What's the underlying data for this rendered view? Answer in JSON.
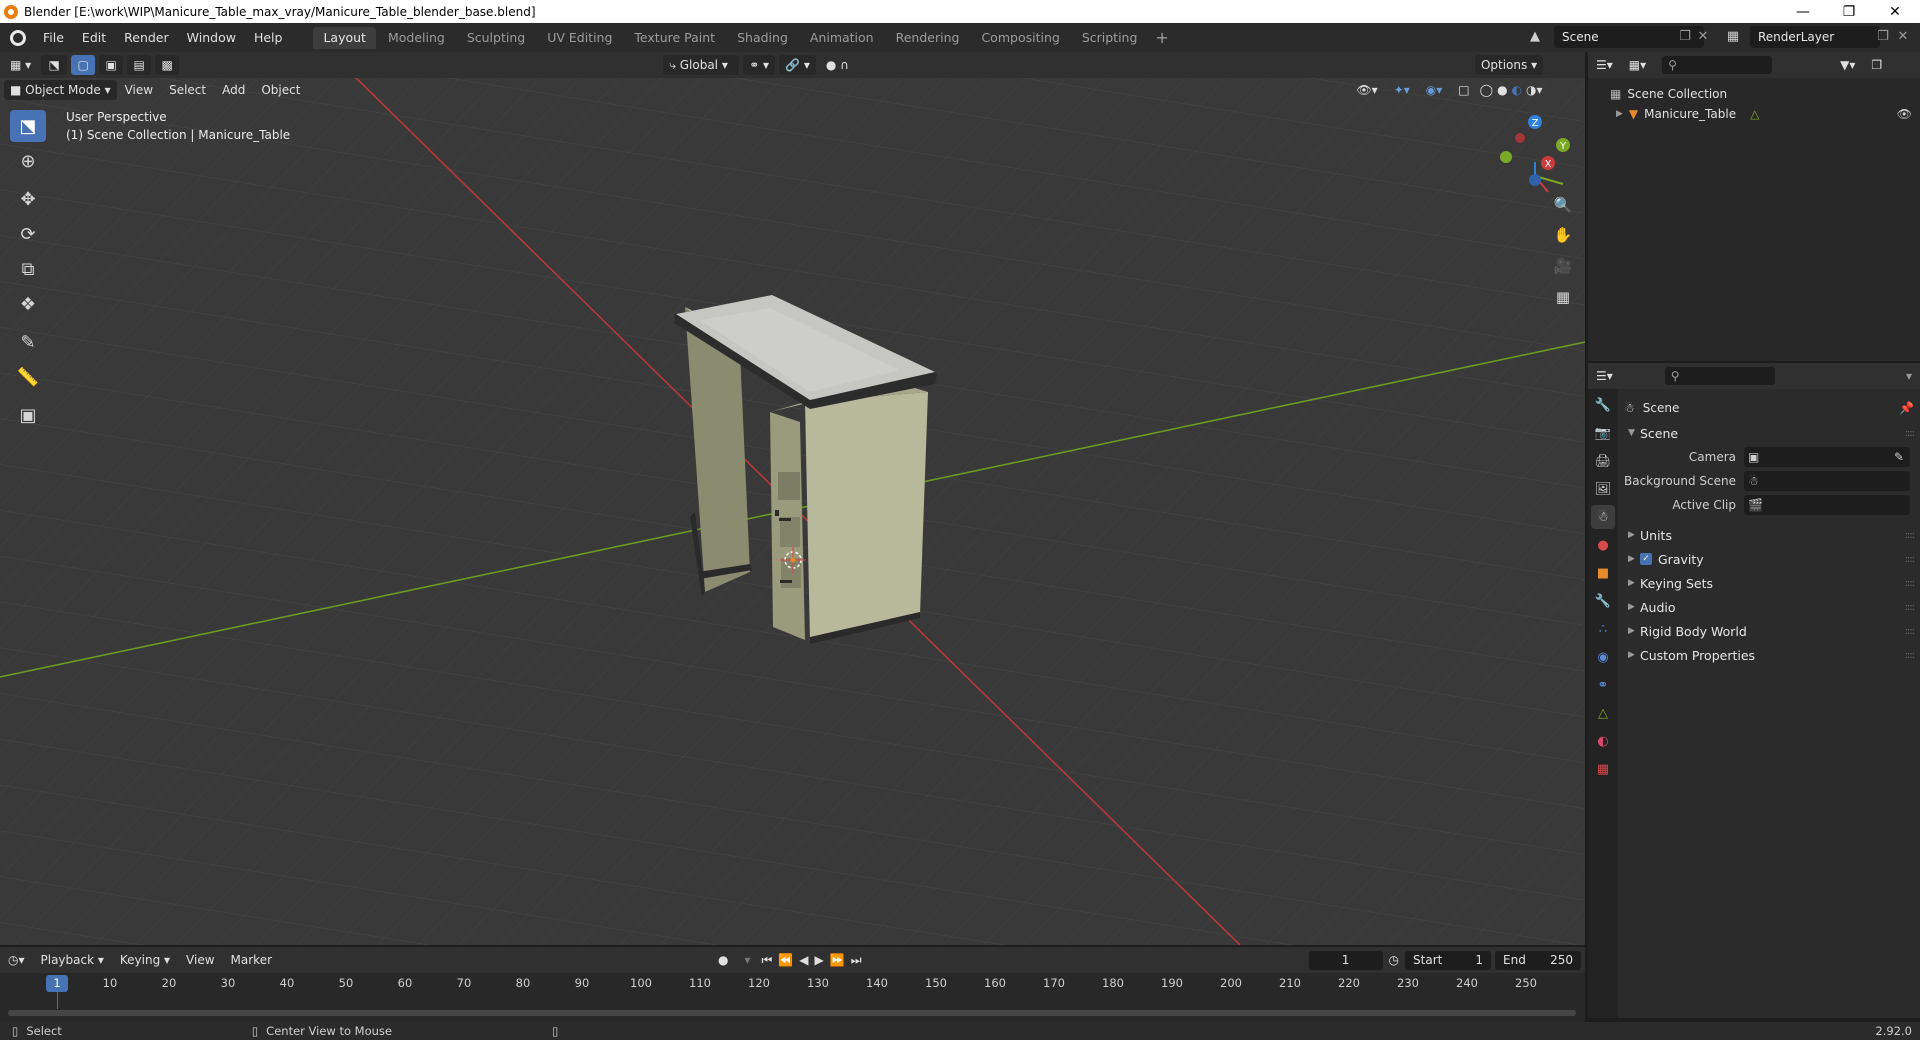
{
  "window": {
    "title": "Blender [E:\\work\\WIP\\Manicure_Table_max_vray/Manicure_Table_blender_base.blend]"
  },
  "menubar": {
    "menus": [
      "File",
      "Edit",
      "Render",
      "Window",
      "Help"
    ],
    "workspaces": [
      "Layout",
      "Modeling",
      "Sculpting",
      "UV Editing",
      "Texture Paint",
      "Shading",
      "Animation",
      "Rendering",
      "Compositing",
      "Scripting"
    ],
    "active_workspace": "Layout",
    "scene_name": "Scene",
    "view_layer": "RenderLayer"
  },
  "viewport": {
    "mode": "Object Mode",
    "menus": [
      "View",
      "Select",
      "Add",
      "Object"
    ],
    "transform_orientation": "Global",
    "options_label": "Options",
    "perspective_label": "User Perspective",
    "collection_label": "(1) Scene Collection | Manicure_Table",
    "gizmo_axes": {
      "x": "X",
      "y": "Y",
      "z": "Z"
    }
  },
  "outliner": {
    "root": "Scene Collection",
    "items": [
      {
        "name": "Manicure_Table"
      }
    ]
  },
  "properties": {
    "context_title": "Scene",
    "panel_title": "Scene",
    "fields": [
      {
        "label": "Camera",
        "value": ""
      },
      {
        "label": "Background Scene",
        "value": ""
      },
      {
        "label": "Active Clip",
        "value": ""
      }
    ],
    "subpanels": [
      "Units",
      "Gravity",
      "Keying Sets",
      "Audio",
      "Rigid Body World",
      "Custom Properties"
    ],
    "gravity_checked": true
  },
  "timeline": {
    "menus": [
      "Playback",
      "Keying",
      "View",
      "Marker"
    ],
    "current_frame": "1",
    "start_label": "Start",
    "start": "1",
    "end_label": "End",
    "end": "250",
    "ticks": [
      "10",
      "20",
      "30",
      "40",
      "50",
      "60",
      "70",
      "80",
      "90",
      "100",
      "110",
      "120",
      "130",
      "140",
      "150",
      "160",
      "170",
      "180",
      "190",
      "200",
      "210",
      "220",
      "230",
      "240",
      "250"
    ],
    "frame_marker": "1"
  },
  "statusbar": {
    "left_action": "Select",
    "middle_action": "Center View to Mouse",
    "version": "2.92.0"
  },
  "colors": {
    "accent": "#4772b3",
    "x_axis": "#cc3a3a",
    "y_axis": "#7aa827",
    "z_axis": "#2f82d9",
    "viewport_bg": "#393939"
  }
}
